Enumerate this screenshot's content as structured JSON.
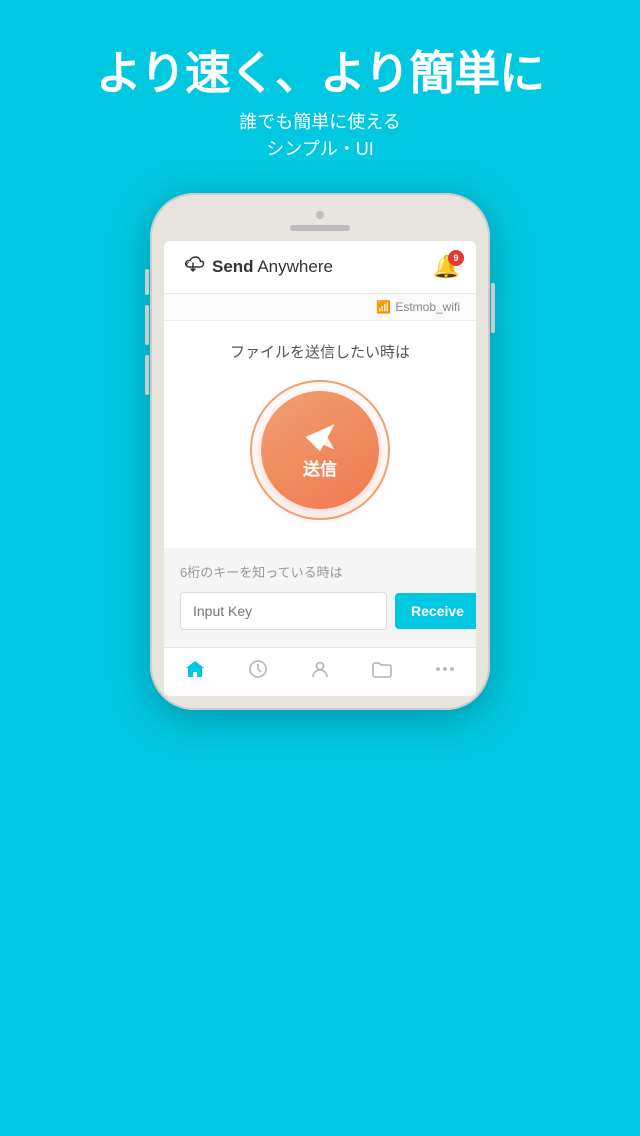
{
  "header": {
    "title_line1": "より速く、より簡単に",
    "subtitle_line1": "誰でも簡単に使える",
    "subtitle_line2": "シンプル・UI"
  },
  "app": {
    "logo_text_bold": "Send",
    "logo_text_regular": " Anywhere",
    "notification_badge": "9",
    "wifi_label": "Estmob_wifi",
    "send_label": "ファイルを送信したい時は",
    "send_button_kanji": "送信",
    "receive_section_label": "6桁のキーを知っている時は",
    "input_placeholder": "Input Key",
    "receive_button_label": "Receive",
    "nav_items": [
      {
        "icon": "home",
        "label": "home",
        "active": true
      },
      {
        "icon": "clock",
        "label": "history",
        "active": false
      },
      {
        "icon": "user",
        "label": "profile",
        "active": false
      },
      {
        "icon": "folder",
        "label": "files",
        "active": false
      },
      {
        "icon": "more",
        "label": "more",
        "active": false
      }
    ]
  },
  "colors": {
    "background": "#00C8E0",
    "send_button": "#f07850",
    "receive_button": "#00C8E0"
  }
}
